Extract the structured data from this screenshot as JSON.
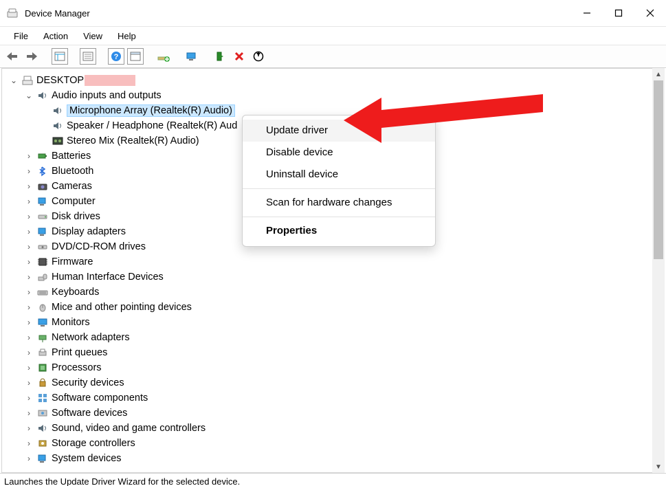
{
  "window": {
    "title": "Device Manager"
  },
  "menubar": {
    "file": "File",
    "action": "Action",
    "view": "View",
    "help": "Help"
  },
  "tree": {
    "root": "DESKTOP",
    "audio_category": "Audio inputs and outputs",
    "devices": {
      "mic": "Microphone Array (Realtek(R) Audio)",
      "speaker": "Speaker / Headphone (Realtek(R) Aud",
      "stereo": "Stereo Mix (Realtek(R) Audio)"
    },
    "categories": {
      "batteries": "Batteries",
      "bluetooth": "Bluetooth",
      "cameras": "Cameras",
      "computer": "Computer",
      "disk_drives": "Disk drives",
      "display_adapters": "Display adapters",
      "dvd": "DVD/CD-ROM drives",
      "firmware": "Firmware",
      "hid": "Human Interface Devices",
      "keyboards": "Keyboards",
      "mice": "Mice and other pointing devices",
      "monitors": "Monitors",
      "network": "Network adapters",
      "print_queues": "Print queues",
      "processors": "Processors",
      "security_devices": "Security devices",
      "software_components": "Software components",
      "software_devices": "Software devices",
      "sound": "Sound, video and game controllers",
      "storage": "Storage controllers",
      "system": "System devices"
    }
  },
  "context_menu": {
    "update": "Update driver",
    "disable": "Disable device",
    "uninstall": "Uninstall device",
    "scan": "Scan for hardware changes",
    "properties": "Properties"
  },
  "statusbar": {
    "text": "Launches the Update Driver Wizard for the selected device."
  },
  "icons": {
    "back": "back-icon",
    "forward": "forward-icon"
  },
  "colors": {
    "selection": "#cce8ff",
    "arrow": "#ee1c1c"
  }
}
